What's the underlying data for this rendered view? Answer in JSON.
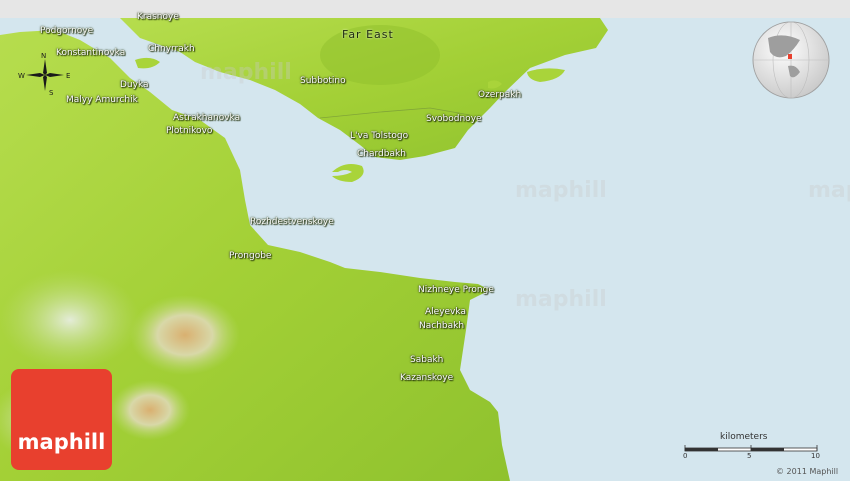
{
  "map": {
    "region_label": "Far East",
    "places": [
      {
        "name": "Krasnoye"
      },
      {
        "name": "Podgornoye"
      },
      {
        "name": "Konstantinovka"
      },
      {
        "name": "Chnyrrakh"
      },
      {
        "name": "Duyka"
      },
      {
        "name": "Malyy Amurchik"
      },
      {
        "name": "Subbotino"
      },
      {
        "name": "Ozerpakh"
      },
      {
        "name": "Svobodnoye"
      },
      {
        "name": "L'va Tolstogo"
      },
      {
        "name": "Chardbakh"
      },
      {
        "name": "Astrakhanovka"
      },
      {
        "name": "Plotnikovo"
      },
      {
        "name": "Rozhdestvenskoye"
      },
      {
        "name": "Prongobe"
      },
      {
        "name": "Nizhneye Pronge"
      },
      {
        "name": "Aleyevka"
      },
      {
        "name": "Nachbakh"
      },
      {
        "name": "Sabakh"
      },
      {
        "name": "Kazanskoye"
      }
    ],
    "watermark": "maphill",
    "compass": {
      "n": "N",
      "e": "E",
      "s": "S",
      "w": "W"
    },
    "scale": {
      "title": "kilometers",
      "ticks": [
        "0",
        "5",
        "10"
      ]
    },
    "logo_text": "maphill",
    "copyright": "© 2011 Maphill",
    "colors": {
      "water": "#d4e6ee",
      "land": "#a9d43a",
      "relief_high": "#d9b070",
      "logo": "#e8402e"
    }
  }
}
